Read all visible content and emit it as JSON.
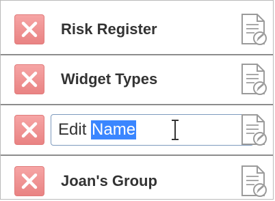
{
  "rows": [
    {
      "label": "Risk Register",
      "delete_icon": "close-icon",
      "action_icon": "document-edit-icon"
    },
    {
      "label": "Widget Types",
      "delete_icon": "close-icon",
      "action_icon": "document-edit-icon"
    },
    {
      "label": "",
      "editing": true,
      "input_prefix": "Edit ",
      "input_selected": "Name",
      "delete_icon": "close-icon",
      "action_icon": "document-edit-icon"
    },
    {
      "label": "Joan's Group",
      "delete_icon": "close-icon",
      "action_icon": "document-edit-icon"
    }
  ],
  "colors": {
    "delete_button": "#eb8e8e",
    "selection": "#3a86ff",
    "row_separator": "#8c8c8c",
    "input_border": "#7c99bd"
  }
}
